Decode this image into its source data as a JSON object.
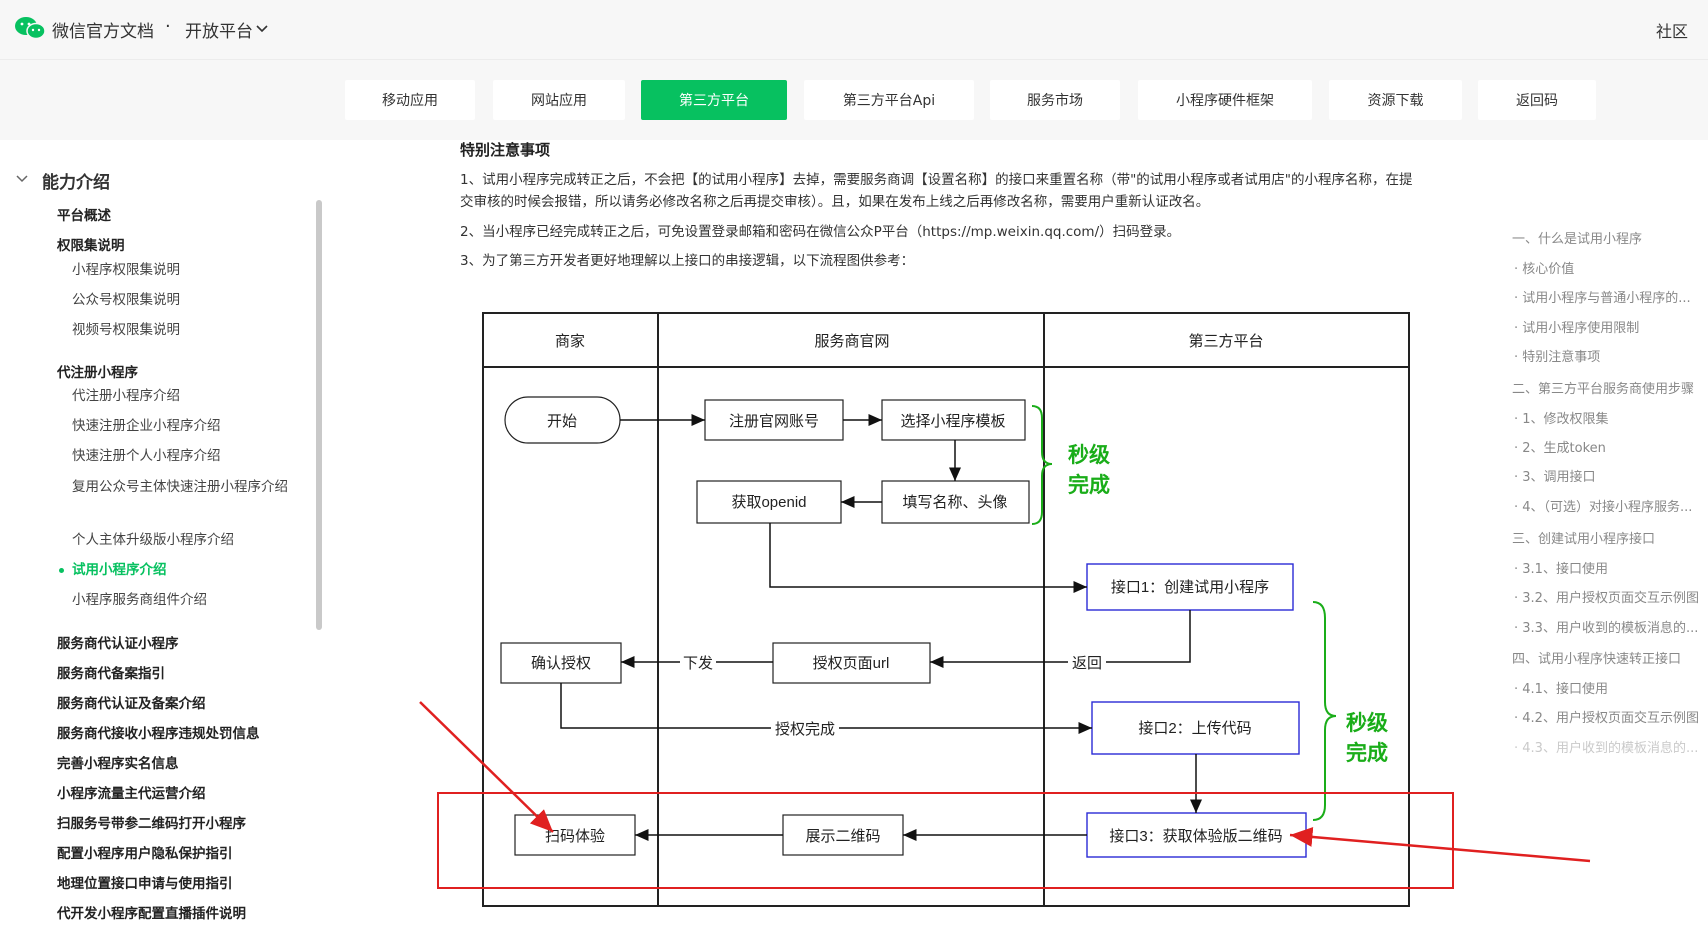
{
  "header": {
    "brand": "微信官方文档",
    "separator": "·",
    "platform": "开放平台",
    "community": "社区"
  },
  "tabs": [
    {
      "label": "移动应用"
    },
    {
      "label": "网站应用"
    },
    {
      "label": "第三方平台"
    },
    {
      "label": "第三方平台Api"
    },
    {
      "label": "服务市场"
    },
    {
      "label": "小程序硬件框架"
    },
    {
      "label": "资源下载"
    },
    {
      "label": "返回码"
    }
  ],
  "sidebar": {
    "section": "能力介绍",
    "items": [
      {
        "label": "平台概述"
      },
      {
        "label": "权限集说明"
      },
      {
        "label": "小程序权限集说明"
      },
      {
        "label": "公众号权限集说明"
      },
      {
        "label": "视频号权限集说明"
      },
      {
        "label": "代注册小程序"
      },
      {
        "label": "代注册小程序介绍"
      },
      {
        "label": "快速注册企业小程序介绍"
      },
      {
        "label": "快速注册个人小程序介绍"
      },
      {
        "label": "复用公众号主体快速注册小程序介绍"
      },
      {
        "label": "个人主体升级版小程序介绍"
      },
      {
        "label": "试用小程序介绍"
      },
      {
        "label": "小程序服务商组件介绍"
      },
      {
        "label": "服务商代认证小程序"
      },
      {
        "label": "服务商代备案指引"
      },
      {
        "label": "服务商代认证及备案介绍"
      },
      {
        "label": "服务商代接收小程序违规处罚信息"
      },
      {
        "label": "完善小程序实名信息"
      },
      {
        "label": "小程序流量主代运营介绍"
      },
      {
        "label": "扫服务号带参二维码打开小程序"
      },
      {
        "label": "配置小程序用户隐私保护指引"
      },
      {
        "label": "地理位置接口申请与使用指引"
      },
      {
        "label": "代开发小程序配置直播插件说明"
      }
    ]
  },
  "article": {
    "heading": "特别注意事项",
    "p1": "1、试用小程序完成转正之后，不会把【的试用小程序】去掉，需要服务商调【设置名称】的接口来重置名称（带\"的试用小程序或者试用店\"的小程序名称，在提交审核的时候会报错，所以请务必修改名称之后再提交审核）。且，如果在发布上线之后再修改名称，需要用户重新认证改名。",
    "p2": "2、当小程序已经完成转正之后，可免设置登录邮箱和密码在微信公众P平台（https://mp.weixin.qq.com/）扫码登录。",
    "p3": "3、为了第三方开发者更好地理解以上接口的串接逻辑，以下流程图供参考："
  },
  "diagram": {
    "lanes": [
      "商家",
      "服务商官网",
      "第三方平台"
    ],
    "nodes": {
      "start": "开始",
      "register": "注册官网账号",
      "choose_template": "选择小程序模板",
      "get_openid": "获取openid",
      "fill_name": "填写名称、头像",
      "api1": "接口1：创建试用小程序",
      "confirm_auth": "确认授权",
      "auth_url": "授权页面url",
      "api2": "接口2：上传代码",
      "scan": "扫码体验",
      "show_qr": "展示二维码",
      "api3": "接口3：获取体验版二维码"
    },
    "edge_labels": {
      "xiafa": "下发",
      "fanhui": "返回",
      "auth_done": "授权完成"
    },
    "brace_labels": [
      "秒级完成",
      "秒级完成"
    ],
    "colors": {
      "green": "#1aad19",
      "blue": "#2b2bd6",
      "red": "#e02020"
    }
  },
  "toc": [
    {
      "label": "一、什么是试用小程序"
    },
    {
      "label": "· 核心价值"
    },
    {
      "label": "· 试用小程序与普通小程序的..."
    },
    {
      "label": "· 试用小程序使用限制"
    },
    {
      "label": "· 特别注意事项"
    },
    {
      "label": "二、第三方平台服务商使用步骤"
    },
    {
      "label": "· 1、修改权限集"
    },
    {
      "label": "· 2、生成token"
    },
    {
      "label": "· 3、调用接口"
    },
    {
      "label": "· 4、（可选）对接小程序服务..."
    },
    {
      "label": "三、创建试用小程序接口"
    },
    {
      "label": "· 3.1、接口使用"
    },
    {
      "label": "· 3.2、用户授权页面交互示例图"
    },
    {
      "label": "· 3.3、用户收到的模板消息的..."
    },
    {
      "label": "四、试用小程序快速转正接口"
    },
    {
      "label": "· 4.1、接口使用"
    },
    {
      "label": "· 4.2、用户授权页面交互示例图"
    },
    {
      "label": "· 4.3、用户收到的模板消息的..."
    }
  ]
}
